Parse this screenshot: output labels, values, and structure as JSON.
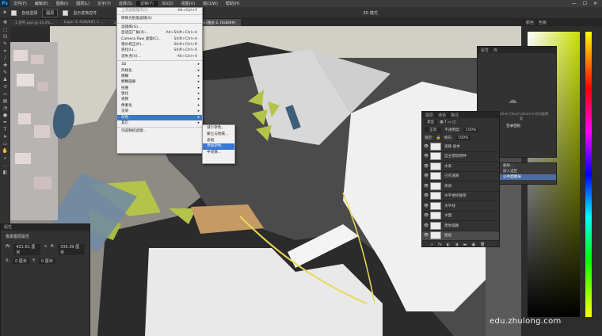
{
  "app": {
    "logo": "Ps"
  },
  "menubar": {
    "items": [
      "文件(F)",
      "编辑(E)",
      "图像(I)",
      "图层(L)",
      "文字(Y)",
      "选择(S)",
      "滤镜(T)",
      "3D(D)",
      "视图(V)",
      "窗口(W)",
      "帮助(H)"
    ],
    "window_controls": [
      "—",
      "☐",
      "✕"
    ]
  },
  "options_bar": {
    "auto_select_label": "自动选择",
    "auto_select_value": "图层",
    "show_transform_label": "显示变换控件",
    "mode_label": "3D 模式"
  },
  "tabs": [
    {
      "label": "1 总平.psd @ 33.3%..."
    },
    {
      "label": "Layer 3, RGB/8#) × ..."
    },
    {
      "label": "2598x7876...(图层 0, RGB/8) ×"
    },
    {
      "label": "...jpg @ 71.5% (图层 2, RGB/8#)"
    }
  ],
  "filter_menu": {
    "items": [
      {
        "label": "上次滤镜操作(F)",
        "shortcut": "Alt+Ctrl+F",
        "disabled": true
      },
      {
        "sep": true
      },
      {
        "label": "转换为智能滤镜(S)"
      },
      {
        "sep": true
      },
      {
        "label": "滤镜库(G)..."
      },
      {
        "label": "自适应广角(A)...",
        "shortcut": "Alt+Shift+Ctrl+A"
      },
      {
        "label": "Camera Raw 滤镜(C)...",
        "shortcut": "Shift+Ctrl+A"
      },
      {
        "label": "镜头校正(R)...",
        "shortcut": "Shift+Ctrl+R"
      },
      {
        "label": "液化(L)...",
        "shortcut": "Shift+Ctrl+X"
      },
      {
        "label": "消失点(V)...",
        "shortcut": "Alt+Ctrl+V"
      },
      {
        "sep": true
      },
      {
        "label": "3D",
        "arrow": true
      },
      {
        "label": "风格化",
        "arrow": true
      },
      {
        "label": "模糊",
        "arrow": true
      },
      {
        "label": "模糊画廊",
        "arrow": true
      },
      {
        "label": "扭曲",
        "arrow": true
      },
      {
        "label": "锐化",
        "arrow": true
      },
      {
        "label": "视频",
        "arrow": true
      },
      {
        "label": "像素化",
        "arrow": true
      },
      {
        "label": "渲染",
        "arrow": true
      },
      {
        "label": "杂色",
        "arrow": true,
        "highlight": true
      },
      {
        "label": "其它",
        "arrow": true
      },
      {
        "sep": true
      },
      {
        "label": "浏览联机滤镜..."
      }
    ]
  },
  "noise_submenu": {
    "items": [
      {
        "label": "减少杂色..."
      },
      {
        "label": "蒙尘与划痕..."
      },
      {
        "label": "去斑"
      },
      {
        "label": "添加杂色...",
        "highlight": true
      },
      {
        "label": "中间值..."
      }
    ]
  },
  "right_dock": {
    "tabs": [
      "颜色",
      "色板"
    ]
  },
  "library_panel": {
    "tabs": [
      "属性",
      "库"
    ],
    "message": "Creative Cloud Libraries 的功能需要",
    "button": "登录面板"
  },
  "layers_panel": {
    "tabs": [
      "图层",
      "通道",
      "路径"
    ],
    "kind": "类型",
    "blend_mode": "正常",
    "opacity_label": "不透明度:",
    "opacity": "100%",
    "lock_label": "锁定:",
    "fill_label": "填充:",
    "fill": "100%",
    "layers": [
      {
        "name": "道路 副本",
        "selected": false
      },
      {
        "name": "自主建筑物种",
        "selected": false
      },
      {
        "name": "水系",
        "selected": false
      },
      {
        "name": "已有道路",
        "selected": false
      },
      {
        "name": "桥梁",
        "selected": false
      },
      {
        "name": "水平坐标轴草",
        "selected": false
      },
      {
        "name": "水平线",
        "selected": false
      },
      {
        "name": "水面",
        "selected": false
      },
      {
        "name": "原地铺路",
        "selected": false
      },
      {
        "name": "图层",
        "selected": true
      }
    ]
  },
  "layer_menu": {
    "items": [
      {
        "label": "删除...",
        "selected": false
      },
      {
        "label": "嵌入选区",
        "selected": false
      },
      {
        "label": "公共面图层",
        "selected": true
      }
    ]
  },
  "properties_panel": {
    "tabs": [
      "属性"
    ],
    "title": "像素图层属性",
    "w_label": "W:",
    "w_value": "421.61 厘米",
    "h_label": "H:",
    "h_value": "336.39 厘米",
    "x_label": "X:",
    "x_value": "0 厘米",
    "y_label": "Y:",
    "y_value": "0 厘米"
  },
  "watermark": "edu.zhulong.com",
  "colors": {
    "menu_highlight": "#3875d7",
    "road": "#4a4a4a",
    "plaza": "#c9c7bb",
    "lawn": "#b4c34a",
    "water": "#3e5e78"
  },
  "icons": [
    "move-icon",
    "marquee-icon",
    "lasso-icon",
    "quick-select-icon",
    "crop-icon",
    "eyedropper-icon",
    "brush-icon",
    "stamp-icon",
    "eraser-icon",
    "gradient-icon",
    "pen-icon",
    "type-icon",
    "hand-icon",
    "zoom-icon",
    "eye-icon",
    "lock-icon",
    "link-icon",
    "folder-icon",
    "trash-icon"
  ]
}
